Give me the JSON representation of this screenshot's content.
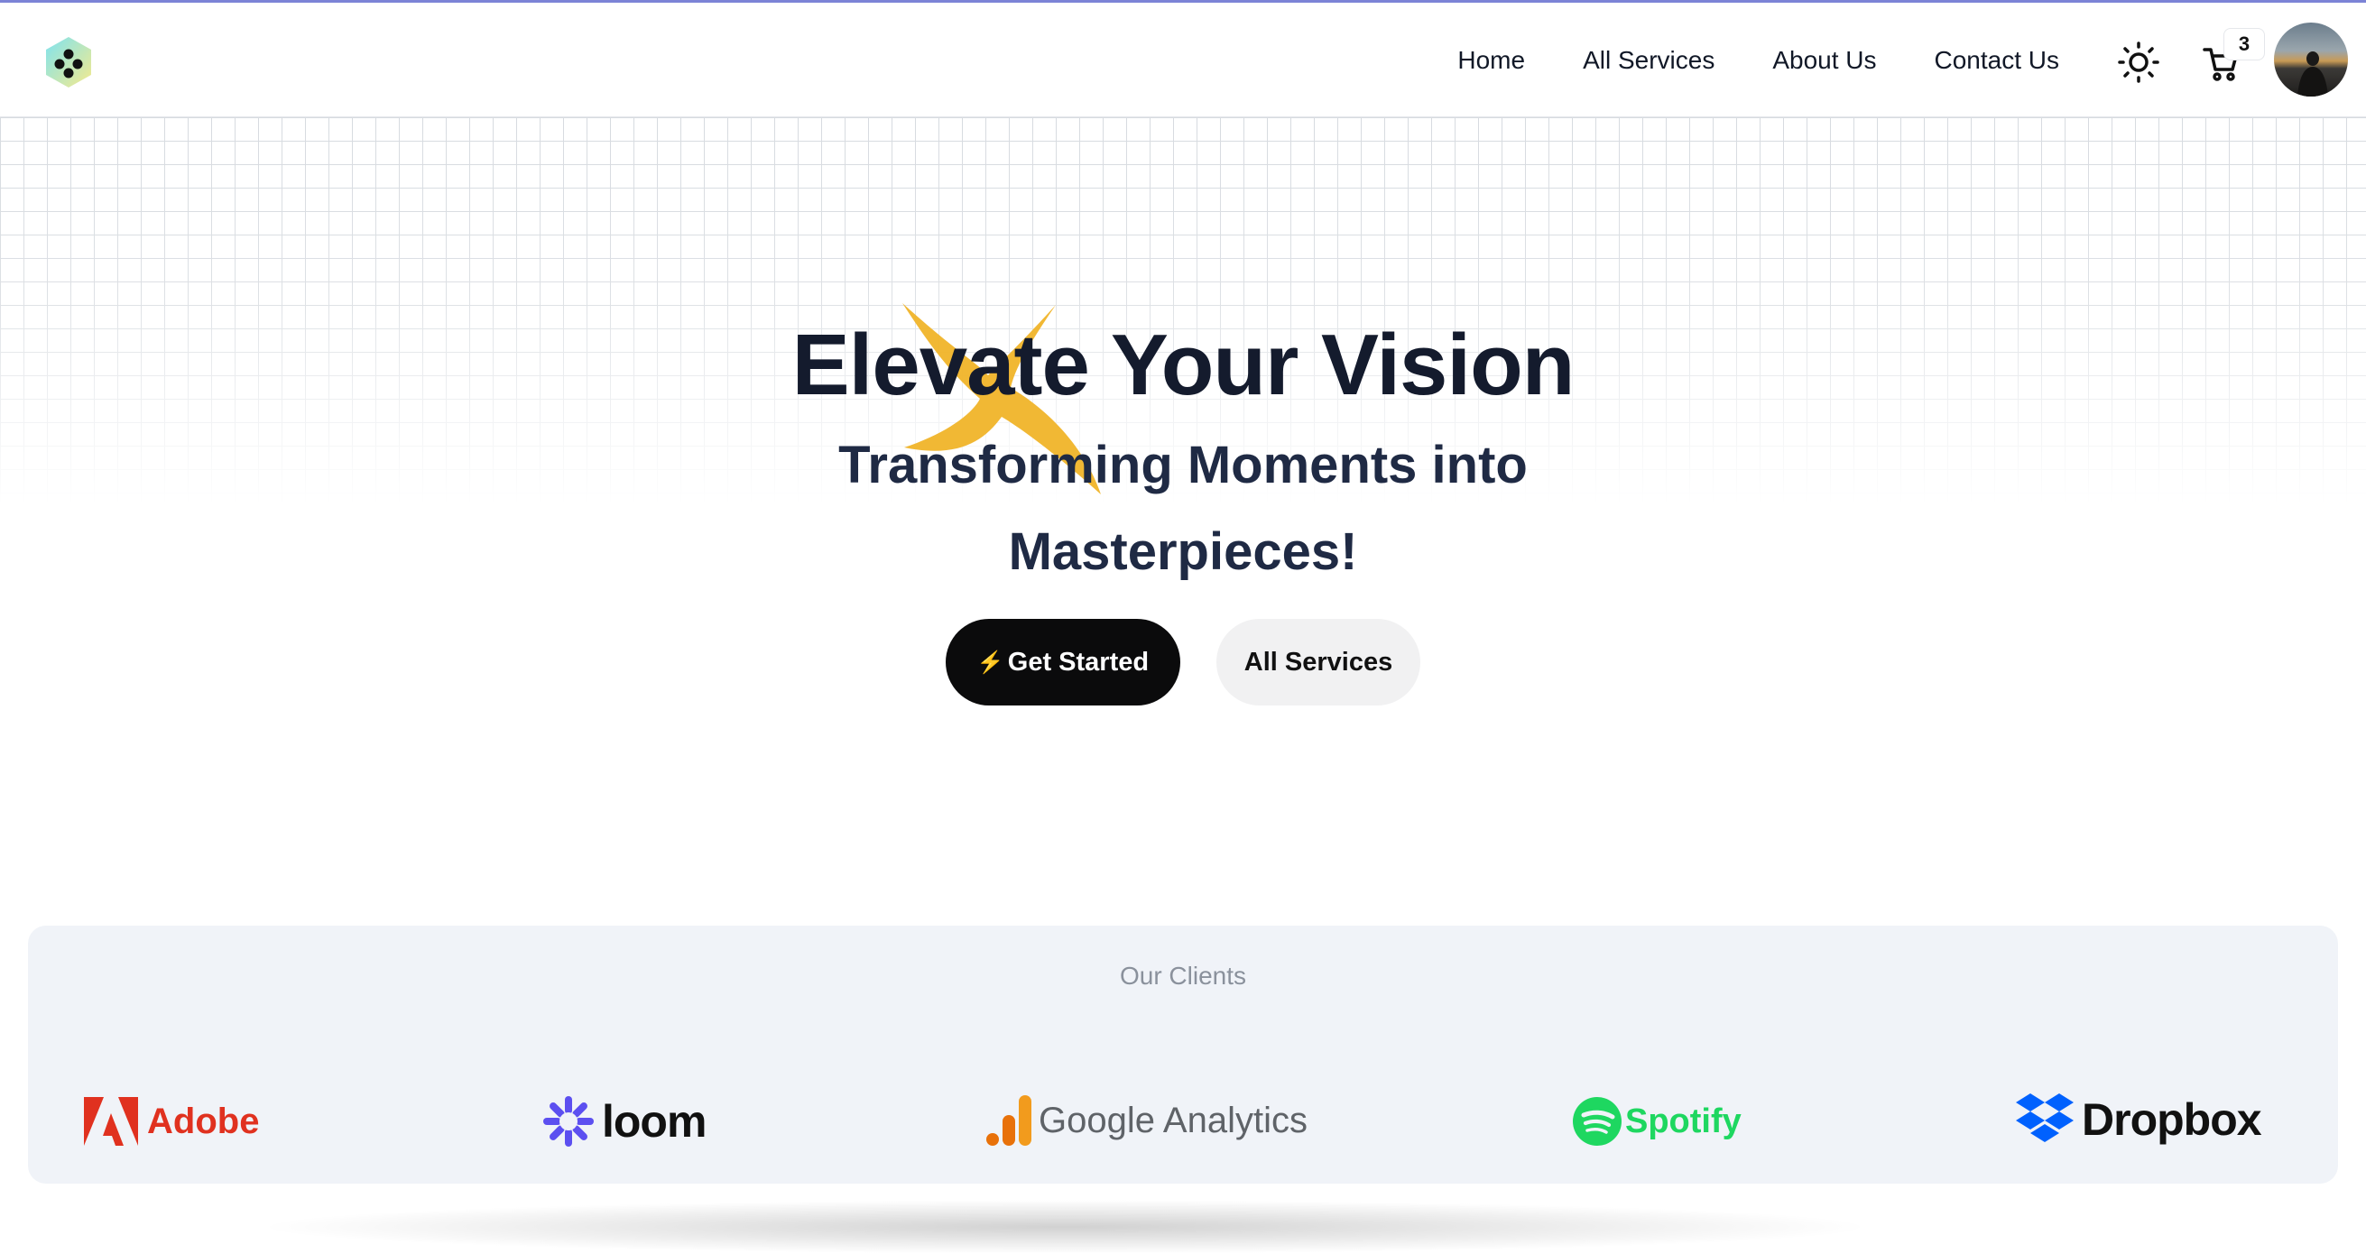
{
  "nav": {
    "logo_icon": "hexagon-dots-logo",
    "links": [
      "Home",
      "All Services",
      "About Us",
      "Contact Us"
    ],
    "theme_icon": "sun-icon",
    "cart_icon": "cart-icon",
    "cart_count": "3",
    "avatar_icon": "user-avatar"
  },
  "hero": {
    "title": "Elevate Your Vision",
    "subtitle_line1": "Transforming Moments into",
    "subtitle_line2": "Masterpieces!",
    "primary_button_icon": "⚡",
    "primary_button": "Get Started",
    "secondary_button": "All Services",
    "sparkle_color": "#f0b429"
  },
  "clients": {
    "title": "Our Clients",
    "logos": [
      "Adobe",
      "loom",
      "Google Analytics",
      "Spotify",
      "Dropbox"
    ]
  },
  "colors": {
    "adobe": "#e0311f",
    "loom": "#5c4ff0",
    "google_analytics_bars": "#f29b1d",
    "spotify": "#1ed760",
    "dropbox": "#0061fe"
  }
}
